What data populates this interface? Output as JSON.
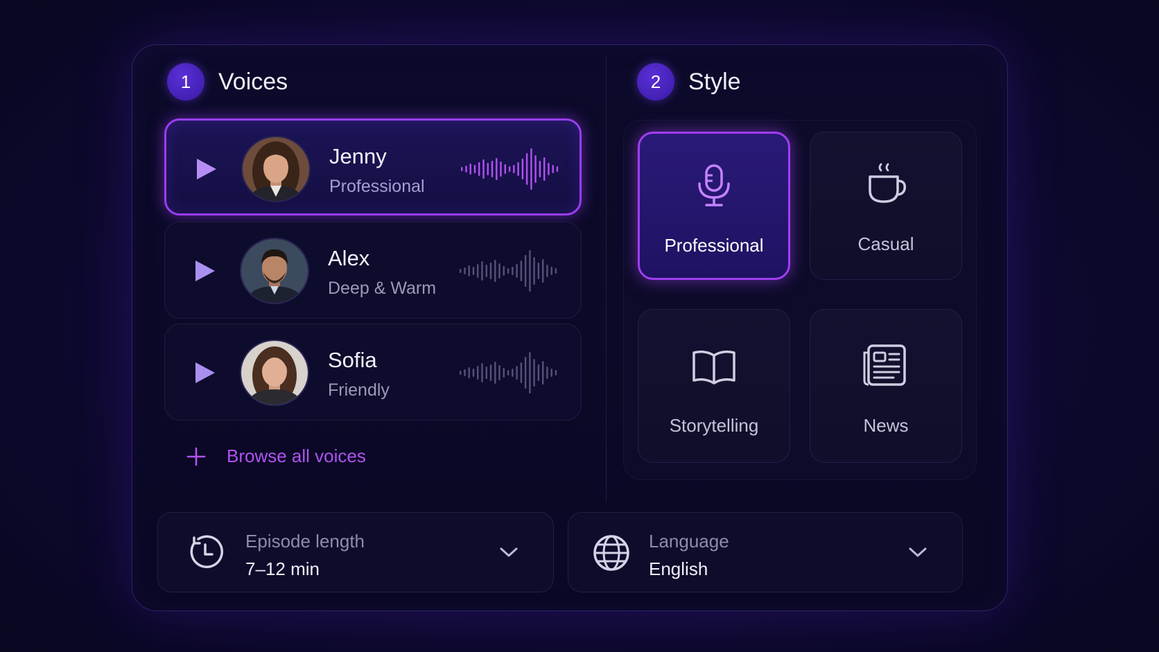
{
  "voices_section": {
    "step": "1",
    "title": "Voices",
    "items": [
      {
        "name": "Jenny",
        "description": "Professional",
        "selected": true
      },
      {
        "name": "Alex",
        "description": "Deep & Warm",
        "selected": false
      },
      {
        "name": "Sofia",
        "description": "Friendly",
        "selected": false
      }
    ],
    "browse_label": "Browse all voices"
  },
  "style_section": {
    "step": "2",
    "title": "Style",
    "options": [
      {
        "label": "Professional",
        "icon": "microphone-icon",
        "selected": true
      },
      {
        "label": "Casual",
        "icon": "coffee-cup-icon",
        "selected": false
      },
      {
        "label": "Storytelling",
        "icon": "book-icon",
        "selected": false
      },
      {
        "label": "News",
        "icon": "newspaper-icon",
        "selected": false
      }
    ]
  },
  "settings": {
    "episode_length": {
      "label": "Episode length",
      "value": "7–12 min",
      "icon": "clock-icon"
    },
    "language": {
      "label": "Language",
      "value": "English",
      "icon": "globe-icon"
    }
  },
  "colors": {
    "accent": "#a03ef2",
    "accent_link": "#b052f0",
    "badge": "#4a22c4",
    "play": "#a98ff0",
    "background": "#0c0a2a"
  }
}
